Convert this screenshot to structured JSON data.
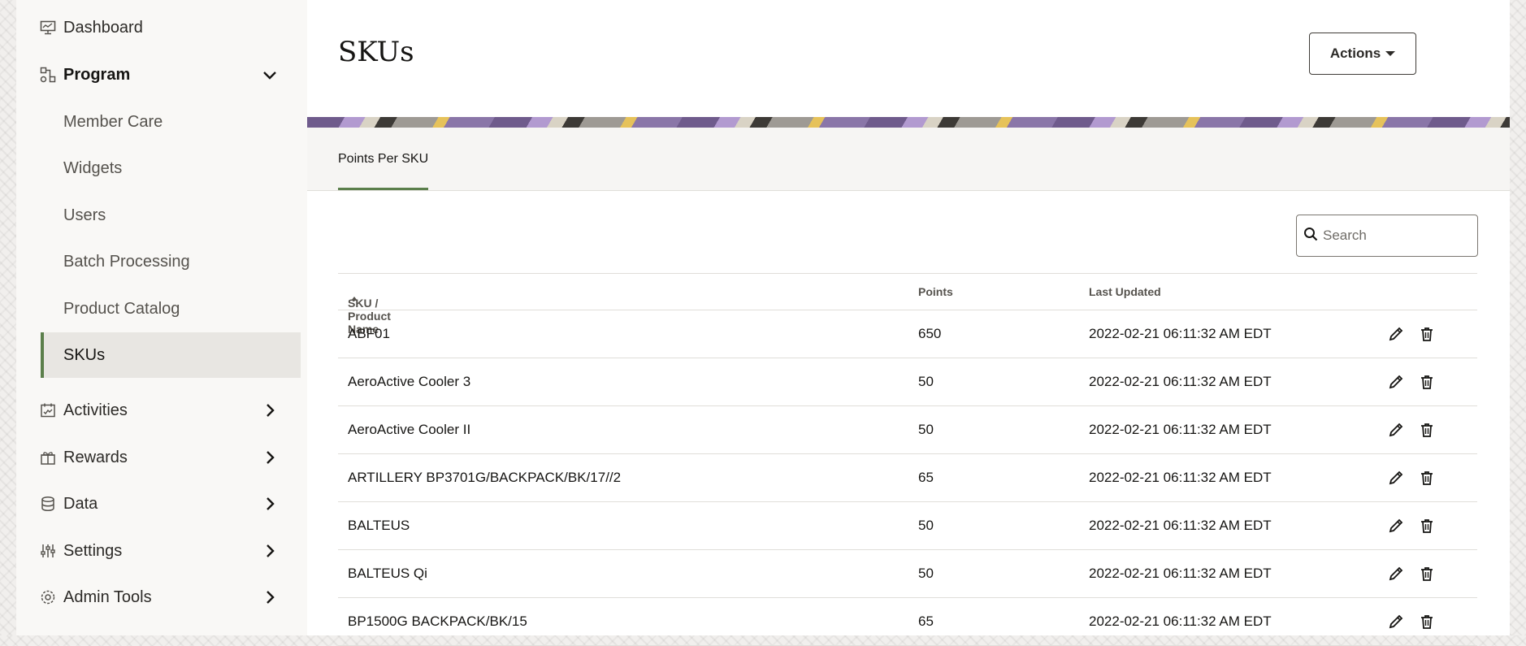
{
  "sidebar": {
    "dashboard": "Dashboard",
    "program": "Program",
    "sub_items": [
      "Member Care",
      "Widgets",
      "Users",
      "Batch Processing",
      "Product Catalog",
      "SKUs"
    ],
    "activities": "Activities",
    "rewards": "Rewards",
    "data": "Data",
    "settings": "Settings",
    "admin_tools": "Admin Tools"
  },
  "page": {
    "title": "SKUs",
    "actions_label": "Actions",
    "tab_label": "Points Per SKU"
  },
  "search": {
    "placeholder": "Search"
  },
  "table": {
    "headers": [
      "SKU / Product Name",
      "Points",
      "Last Updated"
    ],
    "rows": [
      {
        "name": "ABF01",
        "points": "650",
        "updated": "2022-02-21 06:11:32 AM EDT"
      },
      {
        "name": "AeroActive Cooler 3",
        "points": "50",
        "updated": "2022-02-21 06:11:32 AM EDT"
      },
      {
        "name": "AeroActive Cooler II",
        "points": "50",
        "updated": "2022-02-21 06:11:32 AM EDT"
      },
      {
        "name": "ARTILLERY BP3701G/BACKPACK/BK/17//2",
        "points": "65",
        "updated": "2022-02-21 06:11:32 AM EDT"
      },
      {
        "name": "BALTEUS",
        "points": "50",
        "updated": "2022-02-21 06:11:32 AM EDT"
      },
      {
        "name": "BALTEUS Qi",
        "points": "50",
        "updated": "2022-02-21 06:11:32 AM EDT"
      },
      {
        "name": "BP1500G BACKPACK/BK/15",
        "points": "65",
        "updated": "2022-02-21 06:11:32 AM EDT"
      }
    ]
  },
  "colors": {
    "accent": "#5b7f4b",
    "active_bg": "#e8e6e2"
  }
}
